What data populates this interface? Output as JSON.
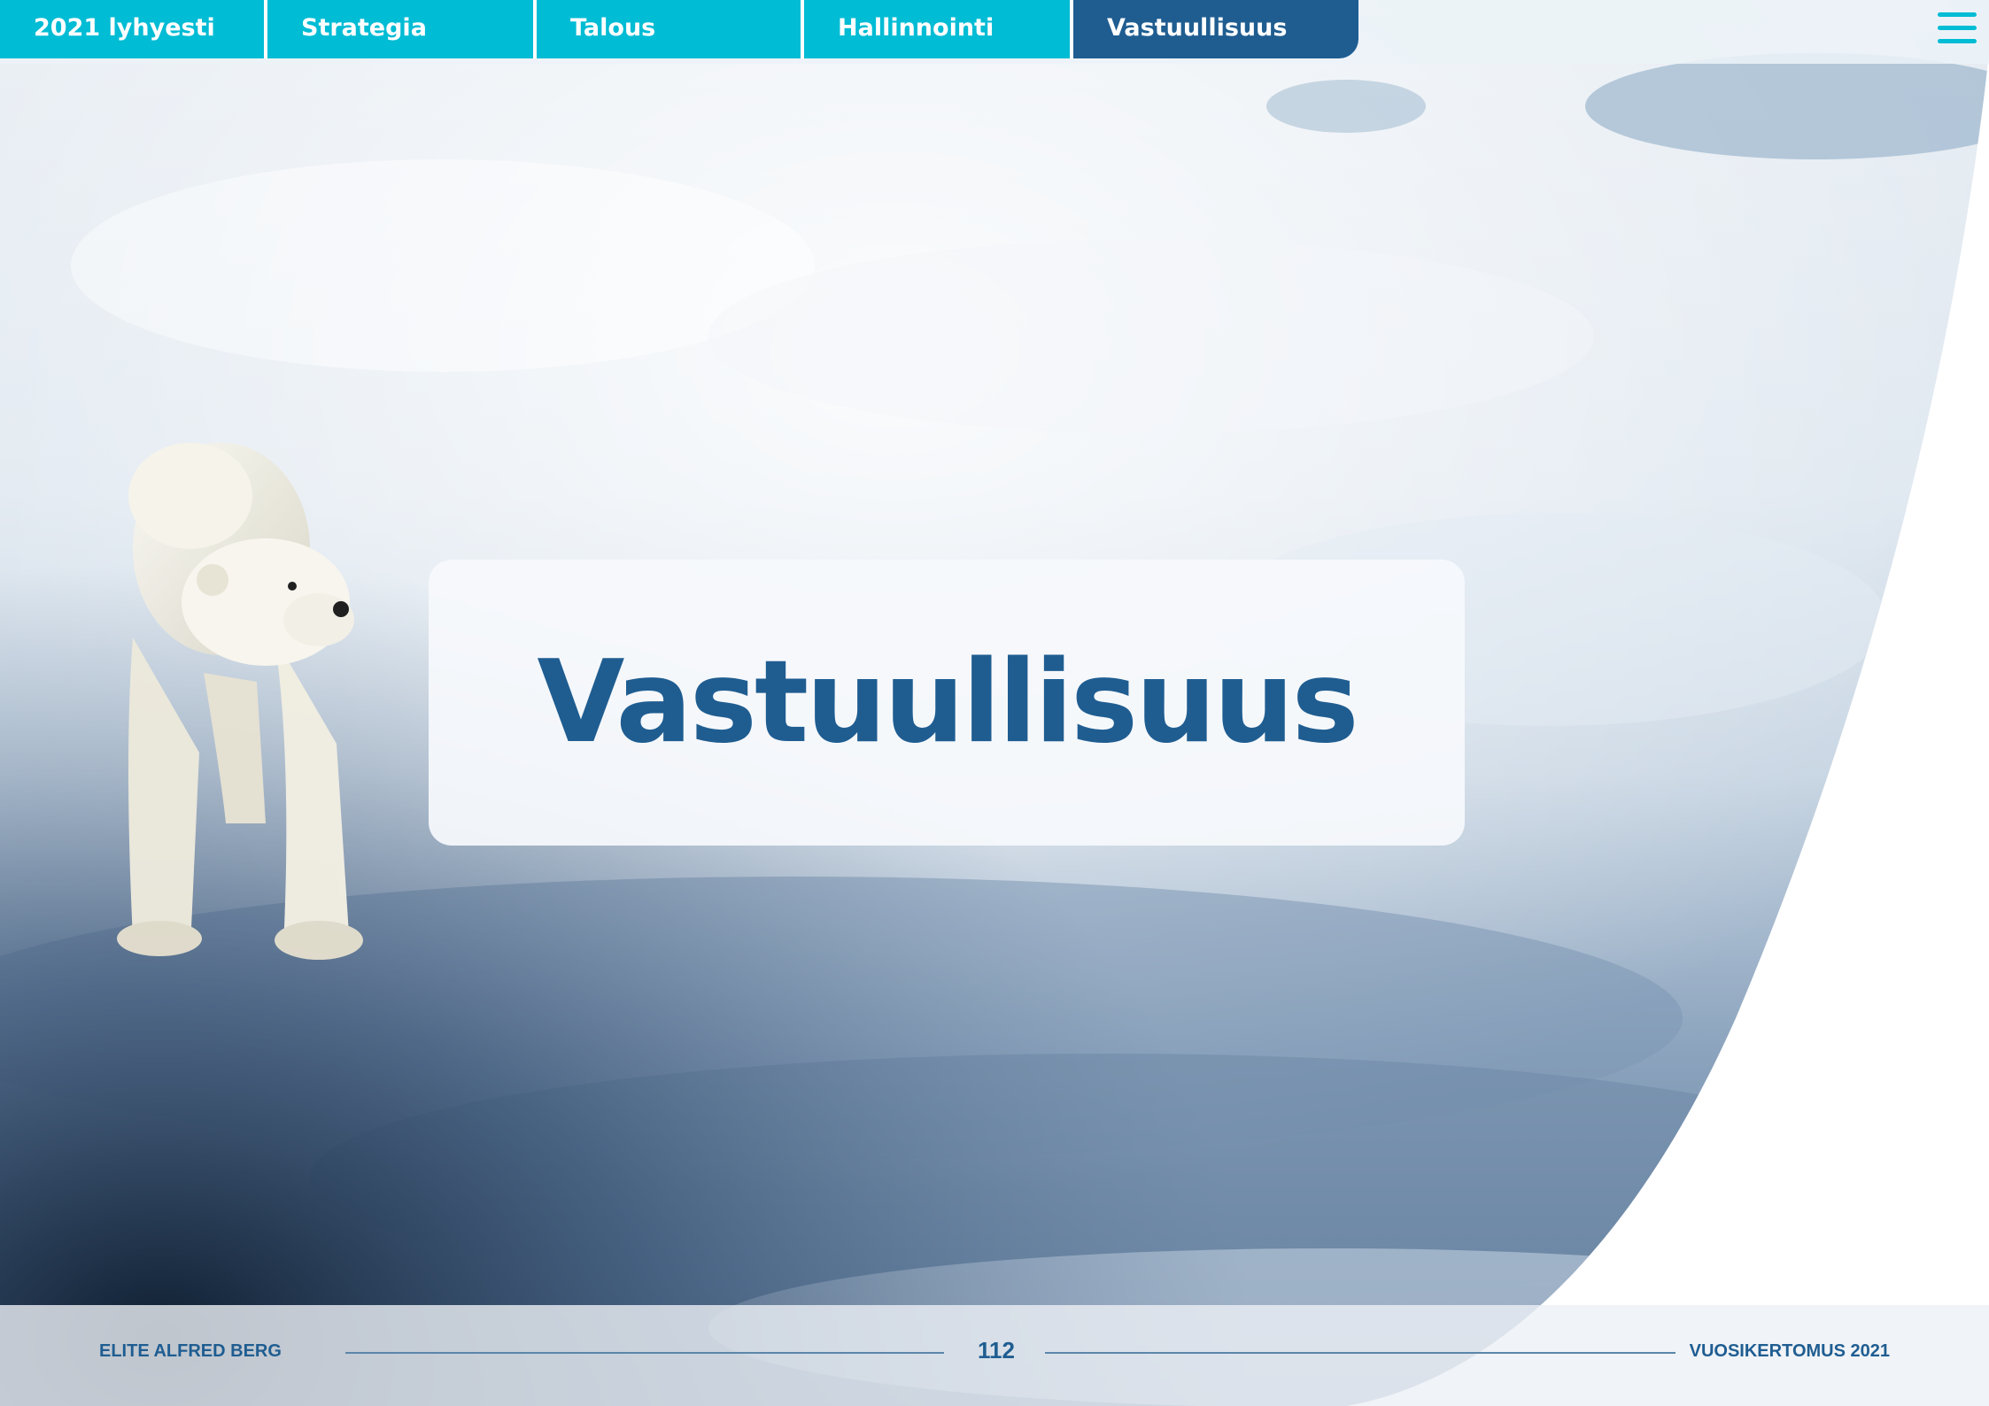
{
  "nav": {
    "tabs": [
      {
        "label": "2021 lyhyesti"
      },
      {
        "label": "Strategia"
      },
      {
        "label": "Talous"
      },
      {
        "label": "Hallinnointi"
      },
      {
        "label": "Vastuullisuus"
      }
    ],
    "active_tab": "Vastuullisuus",
    "menu_icon": "hamburger-menu-icon"
  },
  "main": {
    "title": "Vastuullisuus"
  },
  "footer": {
    "company": "ELITE ALFRED BERG",
    "page_number": "112",
    "report": "VUOSIKERTOMUS 2021"
  },
  "colors": {
    "tab": "#00bcd4",
    "tab_active": "#1f5d91",
    "title": "#1f5d91"
  }
}
